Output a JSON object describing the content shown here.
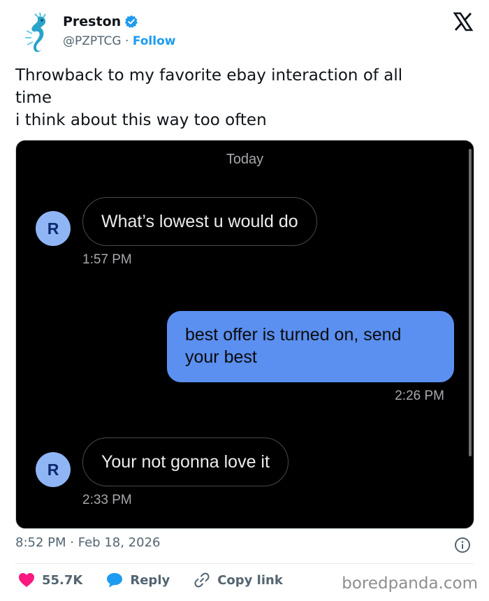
{
  "author": {
    "name": "Preston",
    "handle": "@PZPTCG",
    "separator": "·",
    "follow_label": "Follow"
  },
  "tweet": {
    "lines": [
      "Throwback to my favorite ebay interaction of all",
      "time",
      "i think about this way too often"
    ]
  },
  "chat": {
    "day_label": "Today",
    "messages": [
      {
        "direction": "incoming",
        "sender_initial": "R",
        "text": "What’s lowest u would do",
        "time": "1:57 PM"
      },
      {
        "direction": "outgoing",
        "text": "best offer is turned on, send your best",
        "time": "2:26 PM"
      },
      {
        "direction": "incoming",
        "sender_initial": "R",
        "text": "Your not gonna love it",
        "time": "2:33 PM"
      }
    ],
    "colors": {
      "background": "#000000",
      "outgoing_bubble": "#5b8ff0",
      "avatar": "#8fb5f5"
    }
  },
  "meta": {
    "time": "8:52 PM",
    "separator": "·",
    "date": "Feb 18, 2026"
  },
  "actions": {
    "like_count": "55.7K",
    "reply_label": "Reply",
    "copy_link_label": "Copy link"
  },
  "watermark": "boredpanda.com",
  "colors": {
    "accent": "#1d9bf0",
    "like": "#f91880"
  }
}
